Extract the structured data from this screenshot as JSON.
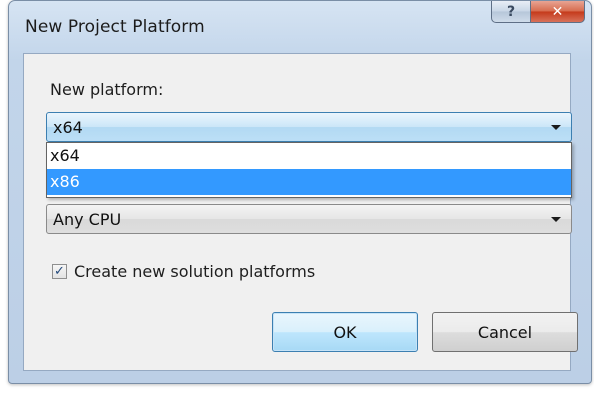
{
  "window": {
    "title": "New Project Platform",
    "help_glyph": "?",
    "close_glyph": "✕"
  },
  "form": {
    "new_platform_label": "New platform:",
    "new_platform_value": "x64",
    "dropdown_options": [
      "x64",
      "x86"
    ],
    "dropdown_highlighted": "x86",
    "copy_settings_value": "Any CPU",
    "create_solution_platforms_label": "Create new solution platforms",
    "create_solution_platforms_checked": true,
    "check_glyph": "✓"
  },
  "buttons": {
    "ok_label": "OK",
    "cancel_label": "Cancel"
  }
}
